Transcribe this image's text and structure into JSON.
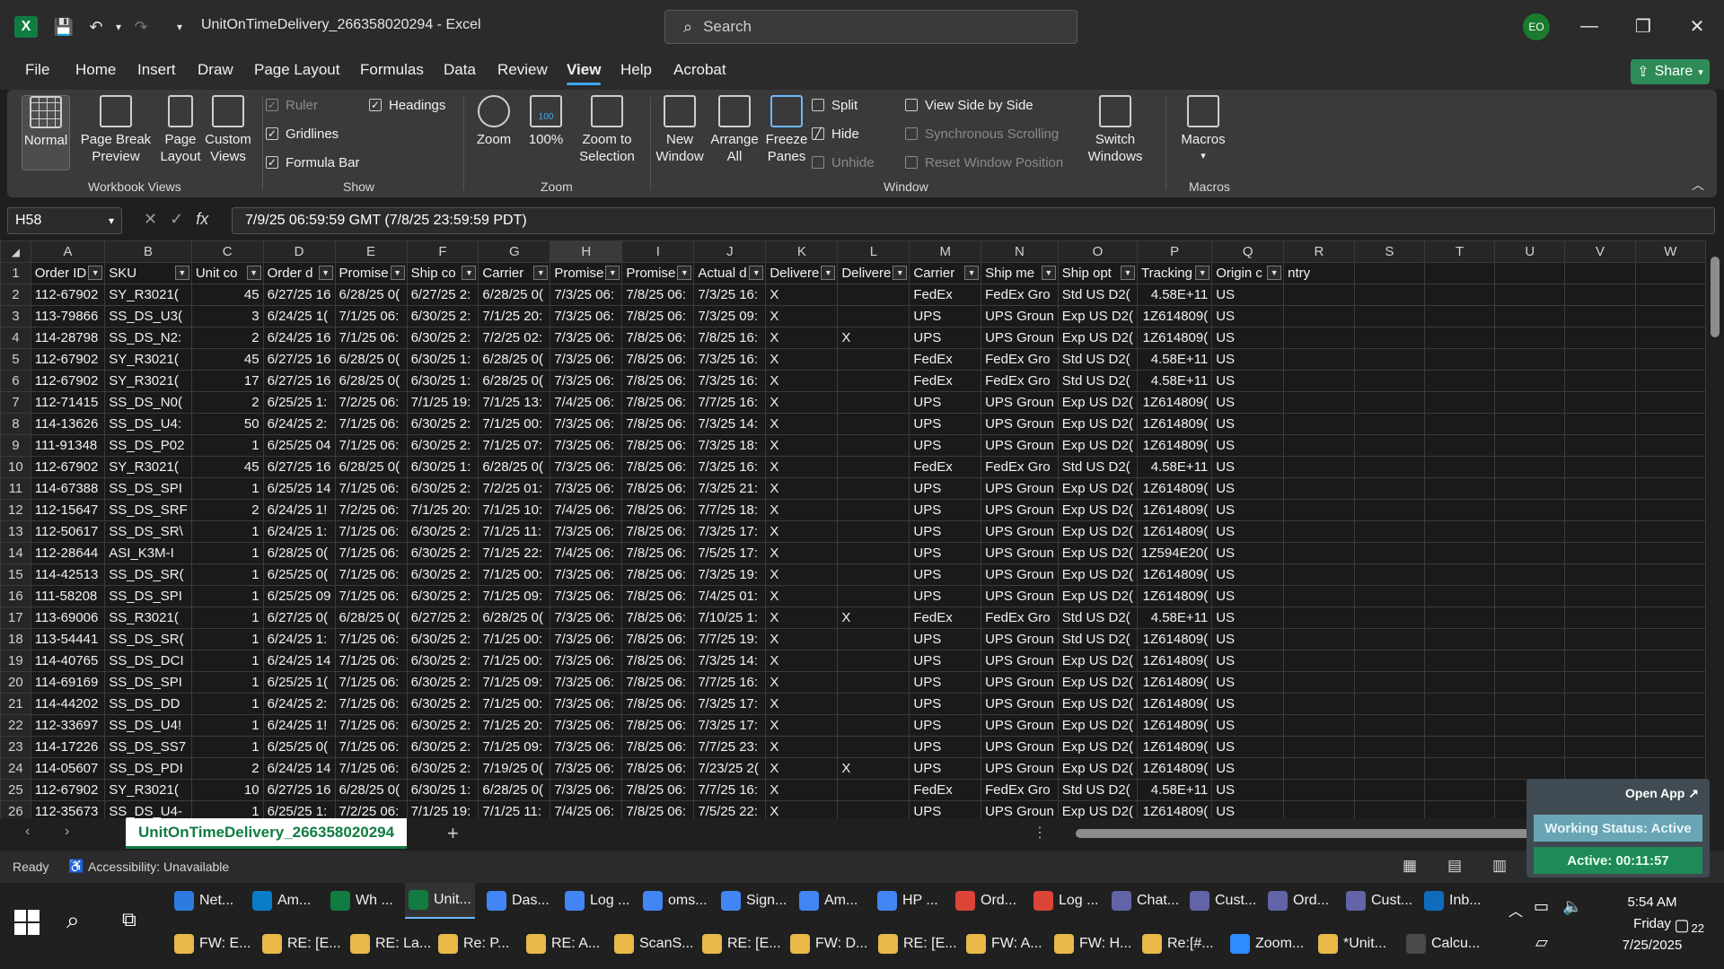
{
  "title_bar": {
    "doc_title": "UnitOnTimeDelivery_266358020294  -  Excel",
    "search_placeholder": "Search",
    "avatar_initials": "EO"
  },
  "menu": {
    "tabs": [
      "File",
      "Home",
      "Insert",
      "Draw",
      "Page Layout",
      "Formulas",
      "Data",
      "Review",
      "View",
      "Help",
      "Acrobat"
    ],
    "active_tab": "View",
    "share_label": "Share"
  },
  "ribbon": {
    "workbook_views": {
      "label": "Workbook Views",
      "normal": "Normal",
      "page_break_1": "Page Break",
      "page_break_2": "Preview",
      "page_layout_1": "Page",
      "page_layout_2": "Layout",
      "custom_1": "Custom",
      "custom_2": "Views"
    },
    "show": {
      "label": "Show",
      "ruler": "Ruler",
      "gridlines": "Gridlines",
      "formula_bar": "Formula Bar",
      "headings": "Headings"
    },
    "zoom": {
      "label": "Zoom",
      "zoom": "Zoom",
      "hundred": "100%",
      "zoom_sel_1": "Zoom to",
      "zoom_sel_2": "Selection",
      "hundred_badge": "100"
    },
    "window": {
      "label": "Window",
      "new_1": "New",
      "new_2": "Window",
      "arrange_1": "Arrange",
      "arrange_2": "All",
      "freeze_1": "Freeze",
      "freeze_2": "Panes",
      "split": "Split",
      "hide": "Hide",
      "unhide": "Unhide",
      "side_by_side": "View Side by Side",
      "sync_scroll": "Synchronous Scrolling",
      "reset_pos": "Reset Window Position",
      "switch_1": "Switch",
      "switch_2": "Windows"
    },
    "macros": {
      "label": "Macros",
      "btn": "Macros"
    }
  },
  "formula_bar": {
    "name_box": "H58",
    "formula": "7/9/25 06:59:59 GMT (7/8/25 23:59:59 PDT)"
  },
  "grid": {
    "columns": [
      "A",
      "B",
      "C",
      "D",
      "E",
      "F",
      "G",
      "H",
      "I",
      "J",
      "K",
      "L",
      "M",
      "N",
      "O",
      "P",
      "Q",
      "R",
      "S",
      "T",
      "U",
      "V",
      "W"
    ],
    "header_row": [
      "Order ID",
      "SKU",
      "Unit co",
      "Order d",
      "Promise",
      "Ship co",
      "Carrier",
      "Promise",
      "Promise",
      "Actual d",
      "Delivere",
      "Delivere",
      "Carrier",
      "Ship me",
      "Ship opt",
      "Tracking",
      "Origin c",
      "ntry",
      "",
      "",
      "",
      "",
      ""
    ],
    "rows": [
      [
        "2",
        "112-67902",
        "SY_R3021(",
        "45",
        "6/27/25 16",
        "6/28/25 0(",
        "6/27/25 2:",
        "6/28/25 0(",
        "7/3/25 06:",
        "7/8/25 06:",
        "7/3/25 16:",
        "X",
        "",
        "FedEx",
        "FedEx Gro",
        "Std US D2(",
        "4.58E+11",
        "US"
      ],
      [
        "3",
        "113-79866",
        "SS_DS_U3(",
        "3",
        "6/24/25 1(",
        "7/1/25 06:",
        "6/30/25 2:",
        "7/1/25 20:",
        "7/3/25 06:",
        "7/8/25 06:",
        "7/3/25 09:",
        "X",
        "",
        "UPS",
        "UPS Groun",
        "Exp US D2(",
        "1Z614809(",
        "US"
      ],
      [
        "4",
        "114-28798",
        "SS_DS_N2:",
        "2",
        "6/24/25 16",
        "7/1/25 06:",
        "6/30/25 2:",
        "7/2/25 02:",
        "7/3/25 06:",
        "7/8/25 06:",
        "7/8/25 16:",
        "X",
        "X",
        "UPS",
        "UPS Groun",
        "Exp US D2(",
        "1Z614809(",
        "US"
      ],
      [
        "5",
        "112-67902",
        "SY_R3021(",
        "45",
        "6/27/25 16",
        "6/28/25 0(",
        "6/30/25 1:",
        "6/28/25 0(",
        "7/3/25 06:",
        "7/8/25 06:",
        "7/3/25 16:",
        "X",
        "",
        "FedEx",
        "FedEx Gro",
        "Std US D2(",
        "4.58E+11",
        "US"
      ],
      [
        "6",
        "112-67902",
        "SY_R3021(",
        "17",
        "6/27/25 16",
        "6/28/25 0(",
        "6/30/25 1:",
        "6/28/25 0(",
        "7/3/25 06:",
        "7/8/25 06:",
        "7/3/25 16:",
        "X",
        "",
        "FedEx",
        "FedEx Gro",
        "Std US D2(",
        "4.58E+11",
        "US"
      ],
      [
        "7",
        "112-71415",
        "SS_DS_N0(",
        "2",
        "6/25/25 1:",
        "7/2/25 06:",
        "7/1/25 19:",
        "7/1/25 13:",
        "7/4/25 06:",
        "7/8/25 06:",
        "7/7/25 16:",
        "X",
        "",
        "UPS",
        "UPS Groun",
        "Exp US D2(",
        "1Z614809(",
        "US"
      ],
      [
        "8",
        "114-13626",
        "SS_DS_U4:",
        "50",
        "6/24/25 2:",
        "7/1/25 06:",
        "6/30/25 2:",
        "7/1/25 00:",
        "7/3/25 06:",
        "7/8/25 06:",
        "7/3/25 14:",
        "X",
        "",
        "UPS",
        "UPS Groun",
        "Exp US D2(",
        "1Z614809(",
        "US"
      ],
      [
        "9",
        "111-91348",
        "SS_DS_P02",
        "1",
        "6/25/25 04",
        "7/1/25 06:",
        "6/30/25 2:",
        "7/1/25 07:",
        "7/3/25 06:",
        "7/8/25 06:",
        "7/3/25 18:",
        "X",
        "",
        "UPS",
        "UPS Groun",
        "Exp US D2(",
        "1Z614809(",
        "US"
      ],
      [
        "10",
        "112-67902",
        "SY_R3021(",
        "45",
        "6/27/25 16",
        "6/28/25 0(",
        "6/30/25 1:",
        "6/28/25 0(",
        "7/3/25 06:",
        "7/8/25 06:",
        "7/3/25 16:",
        "X",
        "",
        "FedEx",
        "FedEx Gro",
        "Std US D2(",
        "4.58E+11",
        "US"
      ],
      [
        "11",
        "114-67388",
        "SS_DS_SPI",
        "1",
        "6/25/25 14",
        "7/1/25 06:",
        "6/30/25 2:",
        "7/2/25 01:",
        "7/3/25 06:",
        "7/8/25 06:",
        "7/3/25 21:",
        "X",
        "",
        "UPS",
        "UPS Groun",
        "Exp US D2(",
        "1Z614809(",
        "US"
      ],
      [
        "12",
        "112-15647",
        "SS_DS_SRF",
        "2",
        "6/24/25 1!",
        "7/2/25 06:",
        "7/1/25 20:",
        "7/1/25 10:",
        "7/4/25 06:",
        "7/8/25 06:",
        "7/7/25 18:",
        "X",
        "",
        "UPS",
        "UPS Groun",
        "Exp US D2(",
        "1Z614809(",
        "US"
      ],
      [
        "13",
        "112-50617",
        "SS_DS_SR\\",
        "1",
        "6/24/25 1:",
        "7/1/25 06:",
        "6/30/25 2:",
        "7/1/25 11:",
        "7/3/25 06:",
        "7/8/25 06:",
        "7/3/25 17:",
        "X",
        "",
        "UPS",
        "UPS Groun",
        "Exp US D2(",
        "1Z614809(",
        "US"
      ],
      [
        "14",
        "112-28644",
        "ASI_K3M-I",
        "1",
        "6/28/25 0(",
        "7/1/25 06:",
        "6/30/25 2:",
        "7/1/25 22:",
        "7/4/25 06:",
        "7/8/25 06:",
        "7/5/25 17:",
        "X",
        "",
        "UPS",
        "UPS Groun",
        "Exp US D2(",
        "1Z594E20(",
        "US"
      ],
      [
        "15",
        "114-42513",
        "SS_DS_SR(",
        "1",
        "6/25/25 0(",
        "7/1/25 06:",
        "6/30/25 2:",
        "7/1/25 00:",
        "7/3/25 06:",
        "7/8/25 06:",
        "7/3/25 19:",
        "X",
        "",
        "UPS",
        "UPS Groun",
        "Exp US D2(",
        "1Z614809(",
        "US"
      ],
      [
        "16",
        "111-58208",
        "SS_DS_SPI",
        "1",
        "6/25/25 09",
        "7/1/25 06:",
        "6/30/25 2:",
        "7/1/25 09:",
        "7/3/25 06:",
        "7/8/25 06:",
        "7/4/25 01:",
        "X",
        "",
        "UPS",
        "UPS Groun",
        "Exp US D2(",
        "1Z614809(",
        "US"
      ],
      [
        "17",
        "113-69006",
        "SS_R3021(",
        "1",
        "6/27/25 0(",
        "6/28/25 0(",
        "6/27/25 2:",
        "6/28/25 0(",
        "7/3/25 06:",
        "7/8/25 06:",
        "7/10/25 1:",
        "X",
        "X",
        "FedEx",
        "FedEx Gro",
        "Std US D2(",
        "4.58E+11",
        "US"
      ],
      [
        "18",
        "113-54441",
        "SS_DS_SR(",
        "1",
        "6/24/25 1:",
        "7/1/25 06:",
        "6/30/25 2:",
        "7/1/25 00:",
        "7/3/25 06:",
        "7/8/25 06:",
        "7/7/25 19:",
        "X",
        "",
        "UPS",
        "UPS Groun",
        "Std US D2(",
        "1Z614809(",
        "US"
      ],
      [
        "19",
        "114-40765",
        "SS_DS_DCI",
        "1",
        "6/24/25 14",
        "7/1/25 06:",
        "6/30/25 2:",
        "7/1/25 00:",
        "7/3/25 06:",
        "7/8/25 06:",
        "7/3/25 14:",
        "X",
        "",
        "UPS",
        "UPS Groun",
        "Exp US D2(",
        "1Z614809(",
        "US"
      ],
      [
        "20",
        "114-69169",
        "SS_DS_SPI",
        "1",
        "6/25/25 1(",
        "7/1/25 06:",
        "6/30/25 2:",
        "7/1/25 09:",
        "7/3/25 06:",
        "7/8/25 06:",
        "7/7/25 16:",
        "X",
        "",
        "UPS",
        "UPS Groun",
        "Exp US D2(",
        "1Z614809(",
        "US"
      ],
      [
        "21",
        "114-44202",
        "SS_DS_DD",
        "1",
        "6/24/25 2:",
        "7/1/25 06:",
        "6/30/25 2:",
        "7/1/25 00:",
        "7/3/25 06:",
        "7/8/25 06:",
        "7/3/25 17:",
        "X",
        "",
        "UPS",
        "UPS Groun",
        "Exp US D2(",
        "1Z614809(",
        "US"
      ],
      [
        "22",
        "112-33697",
        "SS_DS_U4!",
        "1",
        "6/24/25 1!",
        "7/1/25 06:",
        "6/30/25 2:",
        "7/1/25 20:",
        "7/3/25 06:",
        "7/8/25 06:",
        "7/3/25 17:",
        "X",
        "",
        "UPS",
        "UPS Groun",
        "Exp US D2(",
        "1Z614809(",
        "US"
      ],
      [
        "23",
        "114-17226",
        "SS_DS_SS7",
        "1",
        "6/25/25 0(",
        "7/1/25 06:",
        "6/30/25 2:",
        "7/1/25 09:",
        "7/3/25 06:",
        "7/8/25 06:",
        "7/7/25 23:",
        "X",
        "",
        "UPS",
        "UPS Groun",
        "Exp US D2(",
        "1Z614809(",
        "US"
      ],
      [
        "24",
        "114-05607",
        "SS_DS_PDI",
        "2",
        "6/24/25 14",
        "7/1/25 06:",
        "6/30/25 2:",
        "7/19/25 0(",
        "7/3/25 06:",
        "7/8/25 06:",
        "7/23/25 2(",
        "X",
        "X",
        "UPS",
        "UPS Groun",
        "Exp US D2(",
        "1Z614809(",
        "US"
      ],
      [
        "25",
        "112-67902",
        "SY_R3021(",
        "10",
        "6/27/25 16",
        "6/28/25 0(",
        "6/30/25 1:",
        "6/28/25 0(",
        "7/3/25 06:",
        "7/8/25 06:",
        "7/7/25 16:",
        "X",
        "",
        "FedEx",
        "FedEx Gro",
        "Std US D2(",
        "4.58E+11",
        "US"
      ],
      [
        "26",
        "112-35673",
        "SS_DS_U4-",
        "1",
        "6/25/25 1:",
        "7/2/25 06:",
        "7/1/25 19:",
        "7/1/25 11:",
        "7/4/25 06:",
        "7/8/25 06:",
        "7/5/25 22:",
        "X",
        "",
        "UPS",
        "UPS Groun",
        "Exp US D2(",
        "1Z614809(",
        "US"
      ]
    ]
  },
  "sheet_tabs": {
    "active": "UnitOnTimeDelivery_266358020294",
    "add": "+"
  },
  "status_bar": {
    "ready": "Ready",
    "accessibility": "Accessibility: Unavailable"
  },
  "widget": {
    "open_app": "Open App",
    "working_status": "Working Status: Active",
    "active_timer": "Active: 00:11:57"
  },
  "taskbar": {
    "row1": [
      "Net...",
      "Am...",
      "Wh ...",
      "Unit...",
      "Das...",
      "Log ...",
      "oms...",
      "Sign...",
      "Am...",
      "HP ...",
      "Ord...",
      "Log ...",
      "Chat...",
      "Cust...",
      "Ord...",
      "Cust...",
      "Inb..."
    ],
    "row2": [
      "FW: E...",
      "RE: [E...",
      "RE: La...",
      "Re: P...",
      "RE: A...",
      "ScanS...",
      "RE: [E...",
      "FW: D...",
      "RE: [E...",
      "FW: A...",
      "FW: H...",
      "Re:[#...",
      "Zoom...",
      "*Unit...",
      "Calcu..."
    ],
    "clock_time": "5:54 AM",
    "clock_day": "Friday",
    "clock_date": "7/25/2025",
    "notif_count": "22"
  }
}
